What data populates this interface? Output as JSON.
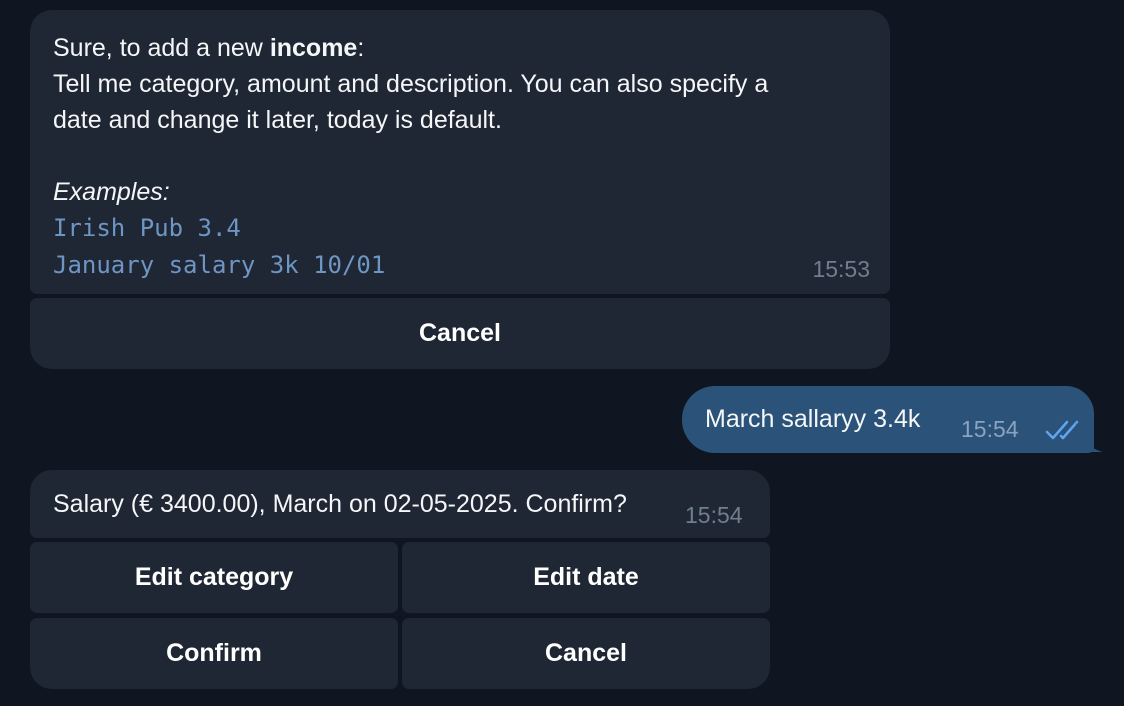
{
  "messages": {
    "income_prompt": {
      "intro_prefix": "Sure, to add a new ",
      "intro_bold": "income",
      "intro_suffix": ":",
      "line2": "Tell me category, amount and description. You can also specify a",
      "line3": "date and change it later, today is default.",
      "examples_label": "Examples:",
      "example1": "Irish Pub 3.4",
      "example2": "January salary 3k 10/01",
      "time": "15:53",
      "buttons": {
        "cancel": "Cancel"
      }
    },
    "user_message": {
      "text": "March sallaryy 3.4k",
      "time": "15:54",
      "status": "double-check-icon"
    },
    "confirm_prompt": {
      "text": "Salary (€ 3400.00), March on 02-05-2025. Confirm?",
      "time": "15:54",
      "buttons": {
        "edit_category": "Edit category",
        "edit_date": "Edit date",
        "confirm": "Confirm",
        "cancel": "Cancel"
      }
    }
  },
  "colors": {
    "background": "#0f1621",
    "incoming_bubble": "#1e2733",
    "outgoing_bubble": "#2b5278",
    "code_text": "#6f95c4",
    "timestamp": "#717e8f",
    "read_checks": "#5fa5f0"
  }
}
